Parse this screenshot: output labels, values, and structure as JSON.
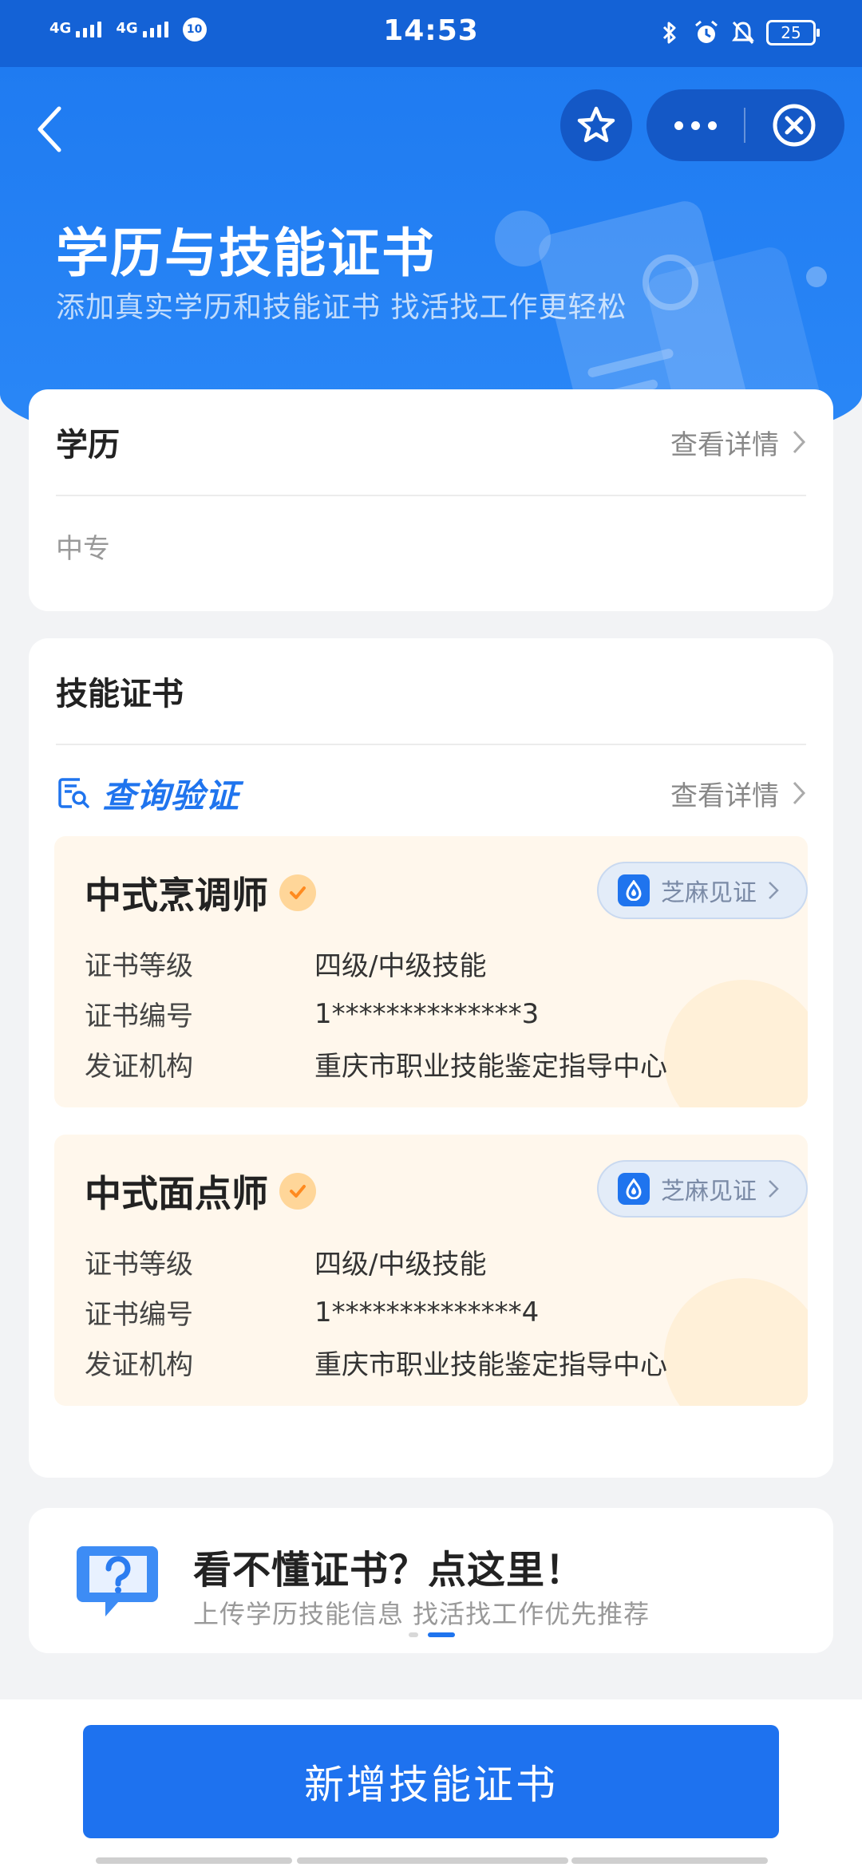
{
  "status_bar": {
    "signal1_label": "4G",
    "signal2_label": "4G",
    "badge": "10",
    "time": "14:53",
    "battery": "25"
  },
  "header": {
    "title": "学历与技能证书",
    "subtitle": "添加真实学历和技能证书 找活找工作更轻松"
  },
  "education": {
    "title": "学历",
    "detail_label": "查看详情",
    "value": "中专"
  },
  "skills": {
    "title": "技能证书",
    "verify_label": "查询验证",
    "detail_label": "查看详情",
    "certificates": [
      {
        "name": "中式烹调师",
        "zhima_label": "芝麻见证",
        "rows": [
          {
            "label": "证书等级",
            "value": "四级/中级技能"
          },
          {
            "label": "证书编号",
            "value": "1**************3"
          },
          {
            "label": "发证机构",
            "value": "重庆市职业技能鉴定指导中心"
          }
        ]
      },
      {
        "name": "中式面点师",
        "zhima_label": "芝麻见证",
        "rows": [
          {
            "label": "证书等级",
            "value": "四级/中级技能"
          },
          {
            "label": "证书编号",
            "value": "1**************4"
          },
          {
            "label": "发证机构",
            "value": "重庆市职业技能鉴定指导中心"
          }
        ]
      }
    ]
  },
  "promo": {
    "title": "看不懂证书？点这里！",
    "subtitle": "上传学历技能信息  找活找工作优先推荐",
    "icon": "question-chat-icon"
  },
  "bottom": {
    "add_button_label": "新增技能证书"
  },
  "colors": {
    "primary": "#1e72ef",
    "header_blue": "#2b88f7",
    "cert_bg": "#fff7ec",
    "verified_badge": "#ff8a1f"
  }
}
